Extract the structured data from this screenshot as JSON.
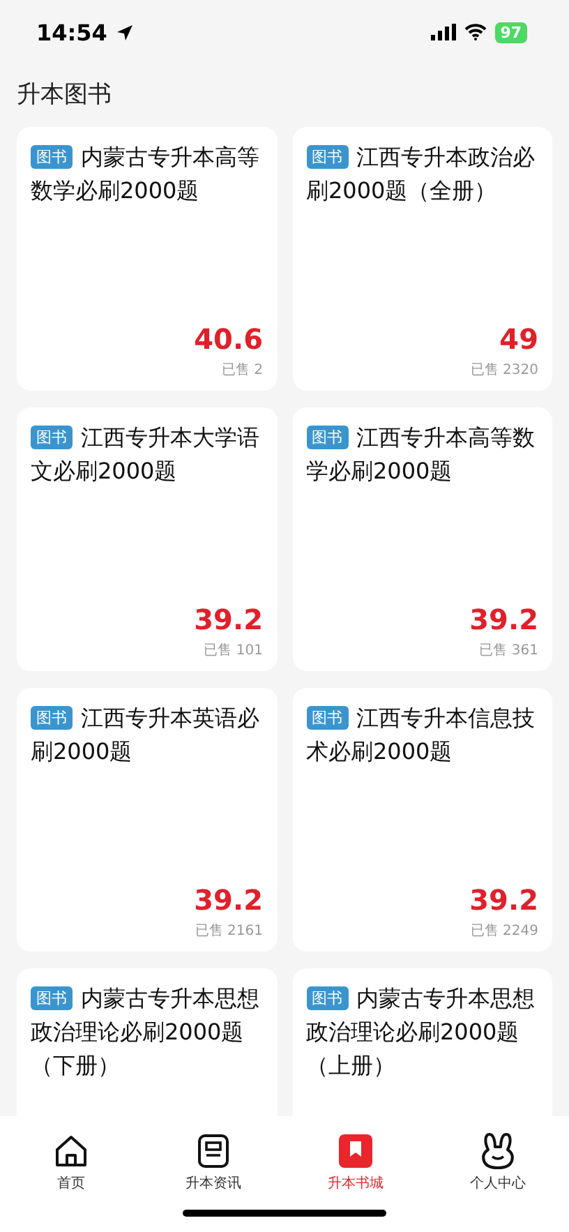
{
  "status_bar": {
    "time": "14:54",
    "battery": "97"
  },
  "page_title": "升本图书",
  "books": [
    {
      "tag": "图书",
      "title": "内蒙古专升本高等数学必刷2000题",
      "price": "40.6",
      "sold": "已售 2"
    },
    {
      "tag": "图书",
      "title": "江西专升本政治必刷2000题（全册）",
      "price": "49",
      "sold": "已售 2320"
    },
    {
      "tag": "图书",
      "title": "江西专升本大学语文必刷2000题",
      "price": "39.2",
      "sold": "已售 101"
    },
    {
      "tag": "图书",
      "title": "江西专升本高等数学必刷2000题",
      "price": "39.2",
      "sold": "已售 361"
    },
    {
      "tag": "图书",
      "title": "江西专升本英语必刷2000题",
      "price": "39.2",
      "sold": "已售 2161"
    },
    {
      "tag": "图书",
      "title": "江西专升本信息技术必刷2000题",
      "price": "39.2",
      "sold": "已售 2249"
    },
    {
      "tag": "图书",
      "title": "内蒙古专升本思想政治理论必刷2000题（下册）"
    },
    {
      "tag": "图书",
      "title": "内蒙古专升本思想政治理论必刷2000题（上册）"
    }
  ],
  "tabs": [
    {
      "kind": "home",
      "label": "首页",
      "selected": false
    },
    {
      "kind": "news",
      "label": "升本资讯",
      "selected": false
    },
    {
      "kind": "store",
      "label": "升本书城",
      "selected": true
    },
    {
      "kind": "profile",
      "label": "个人中心",
      "selected": false
    }
  ]
}
